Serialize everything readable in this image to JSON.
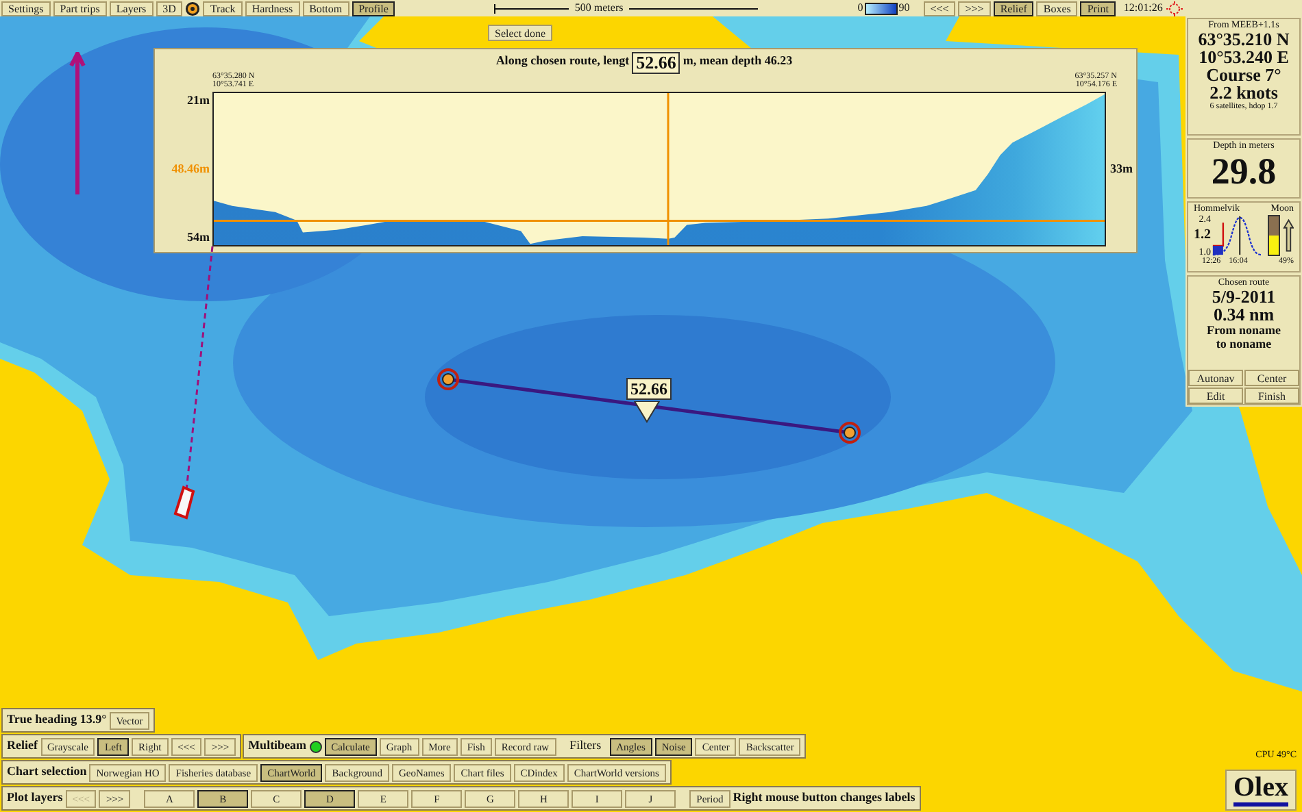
{
  "toolbar": {
    "items": [
      {
        "kind": "button",
        "label": "Settings",
        "selected": false
      },
      {
        "kind": "button",
        "label": "Part trips",
        "selected": false
      },
      {
        "kind": "button",
        "label": "Layers",
        "selected": false
      },
      {
        "kind": "button",
        "label": "3D",
        "selected": false
      },
      {
        "kind": "icon"
      },
      {
        "kind": "button",
        "label": "Track",
        "selected": false
      },
      {
        "kind": "button",
        "label": "Hardness",
        "selected": false
      },
      {
        "kind": "button",
        "label": "Bottom",
        "selected": false
      },
      {
        "kind": "button",
        "label": "Profile",
        "selected": true
      }
    ],
    "scale_label": "500 meters",
    "legend": {
      "min": "0",
      "max": "90"
    },
    "nav_buttons": [
      {
        "label": "<<<",
        "selected": false
      },
      {
        "label": ">>>",
        "selected": false
      },
      {
        "label": "Relief",
        "selected": true
      },
      {
        "label": "Boxes",
        "selected": false
      },
      {
        "label": "Print",
        "selected": true
      }
    ],
    "time": "12:01:26"
  },
  "select_button": "Select done",
  "profile": {
    "title_before": "Along chosen route, lengt",
    "marker": "52.66",
    "title_after": "m, mean depth 46.23",
    "start": [
      "63°35.280 N",
      "10°53.741 E"
    ],
    "end": [
      "63°35.257 N",
      "10°54.176 E"
    ],
    "top_depth": "21m",
    "mean_depth": "48.46m",
    "bottom_depth": "54m",
    "right_depth": "33m"
  },
  "map": {
    "route_label": "52.66"
  },
  "gps": {
    "source": "From MEEB+1.1s",
    "lat": "63°35.210 N",
    "lon": "10°53.240 E",
    "course": "Course 7°",
    "speed": "2.2 knots",
    "satellites": "6 satellites, hdop 1.7"
  },
  "depth": {
    "title": "Depth in meters",
    "value": "29.8"
  },
  "tide": {
    "place": "Hommelvik",
    "high": "2.4",
    "current": "1.2",
    "low": "1.0",
    "times": [
      "12:26",
      "16:04"
    ],
    "moon": {
      "label": "Moon",
      "level": 0.49,
      "reading": "49%"
    }
  },
  "route": {
    "title": "Chosen route",
    "date": "5/9-2011",
    "distance": "0.34 nm",
    "from": "From noname",
    "to": "to noname",
    "buttons": [
      "Autonav",
      "Center",
      "Edit",
      "Finish"
    ]
  },
  "heading": {
    "label": "True heading 13.9°",
    "button": "Vector"
  },
  "relief": {
    "label": "Relief",
    "buttons": [
      {
        "label": "Grayscale",
        "selected": false
      },
      {
        "label": "Left",
        "selected": true
      },
      {
        "label": "Right",
        "selected": false
      },
      {
        "label": "<<<",
        "selected": false
      },
      {
        "label": ">>>",
        "selected": false
      }
    ]
  },
  "multibeam": {
    "label": "Multibeam",
    "on": true,
    "buttons": [
      {
        "label": "Calculate",
        "selected": true
      },
      {
        "label": "Graph",
        "selected": false
      },
      {
        "label": "More",
        "selected": false
      },
      {
        "label": "Fish",
        "selected": false
      },
      {
        "label": "Record raw",
        "selected": false
      }
    ],
    "filters_label": "Filters",
    "filters": [
      {
        "label": "Angles",
        "selected": true
      },
      {
        "label": "Noise",
        "selected": true
      },
      {
        "label": "Center",
        "selected": false
      },
      {
        "label": "Backscatter",
        "selected": false
      }
    ]
  },
  "chart_selection": {
    "label": "Chart selection",
    "buttons": [
      {
        "label": "Norwegian HO",
        "selected": false
      },
      {
        "label": "Fisheries database",
        "selected": false
      },
      {
        "label": "ChartWorld",
        "selected": true
      },
      {
        "label": "Background",
        "selected": false
      },
      {
        "label": "GeoNames",
        "selected": false
      },
      {
        "label": "Chart files",
        "selected": false
      },
      {
        "label": "CDindex",
        "selected": false
      },
      {
        "label": "ChartWorld versions",
        "selected": false
      }
    ]
  },
  "plot_layers": {
    "label": "Plot layers",
    "buttons": [
      {
        "label": "<<<",
        "selected": false,
        "disabled": true
      },
      {
        "label": ">>>",
        "selected": false,
        "disabled": false
      },
      {
        "label": "A",
        "selected": false,
        "disabled": false
      },
      {
        "label": "B",
        "selected": true,
        "disabled": false
      },
      {
        "label": "C",
        "selected": false,
        "disabled": false
      },
      {
        "label": "D",
        "selected": true,
        "disabled": false
      },
      {
        "label": "E",
        "selected": false,
        "disabled": false
      },
      {
        "label": "F",
        "selected": false,
        "disabled": false
      },
      {
        "label": "G",
        "selected": false,
        "disabled": false
      },
      {
        "label": "H",
        "selected": false,
        "disabled": false
      },
      {
        "label": "I",
        "selected": false,
        "disabled": false
      },
      {
        "label": "J",
        "selected": false,
        "disabled": false
      }
    ],
    "period": "Period",
    "hint": "Right mouse button changes labels"
  },
  "cpu": "CPU 49°C",
  "logo": "Olex"
}
